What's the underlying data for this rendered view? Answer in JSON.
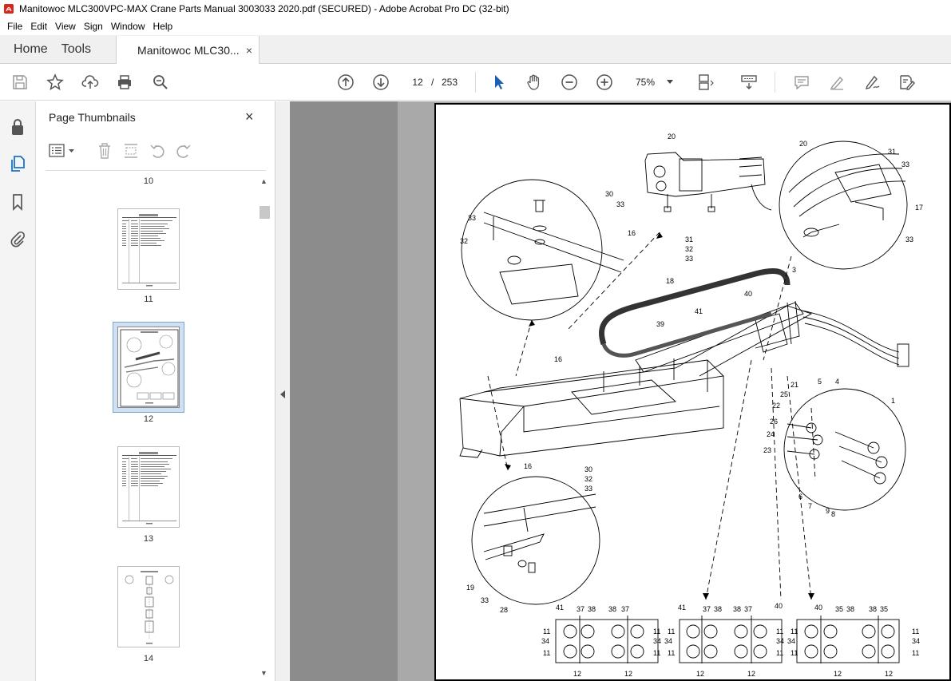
{
  "window": {
    "title": "Manitowoc MLC300VPC-MAX Crane Parts Manual 3003033 2020.pdf (SECURED) - Adobe Acrobat Pro DC (32-bit)"
  },
  "menu": [
    "File",
    "Edit",
    "View",
    "Sign",
    "Window",
    "Help"
  ],
  "tabs": {
    "home": "Home",
    "tools": "Tools",
    "document": "Manitowoc MLC30...",
    "close": "×"
  },
  "toolbar": {
    "page_current": "12",
    "page_separator": "/",
    "page_total": "253",
    "zoom": "75%",
    "icons": [
      "save-icon",
      "bookmark-star-icon",
      "upload-icon",
      "print-icon",
      "zoom-search-icon",
      "prev-page-icon",
      "next-page-icon",
      "select-cursor-icon",
      "hand-icon",
      "zoom-out-icon",
      "zoom-in-icon",
      "page-layout-icon",
      "scroll-mode-icon",
      "comment-icon",
      "highlight-icon",
      "sign-icon",
      "fill-sign-icon"
    ]
  },
  "thumbnails_panel": {
    "title": "Page Thumbnails",
    "close": "×",
    "pages": [
      {
        "label": "10"
      },
      {
        "label": "11"
      },
      {
        "label": "12",
        "selected": true
      },
      {
        "label": "13"
      },
      {
        "label": "14"
      }
    ]
  },
  "drawing": {
    "callouts": [
      "20",
      "20",
      "31",
      "33",
      "17",
      "33",
      "3",
      "30",
      "33",
      "33",
      "16",
      "32",
      "31",
      "32",
      "33",
      "18",
      "40",
      "41",
      "39",
      "16",
      "21",
      "5",
      "4",
      "25",
      "22",
      "1",
      "26",
      "24",
      "23",
      "6",
      "7",
      "9",
      "8",
      "16",
      "30",
      "32",
      "33",
      "19",
      "33",
      "28",
      "41",
      "37",
      "38",
      "38",
      "37",
      "11",
      "34",
      "11",
      "12",
      "12",
      "11",
      "34",
      "11",
      "41",
      "37",
      "38",
      "38",
      "37",
      "40",
      "11",
      "34",
      "11",
      "12",
      "12",
      "11",
      "34",
      "11",
      "40",
      "35",
      "38",
      "38",
      "35",
      "11",
      "34",
      "11",
      "12",
      "12",
      "11",
      "34",
      "11"
    ]
  }
}
